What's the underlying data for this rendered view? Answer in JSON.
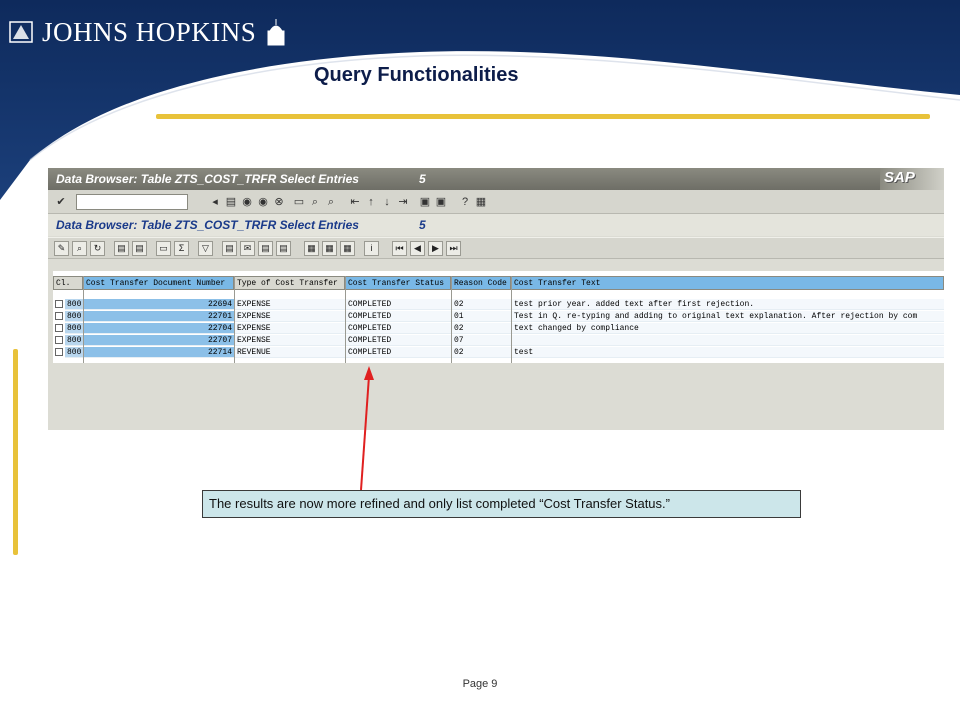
{
  "slide": {
    "brand": "JOHNS HOPKINS",
    "title": "Query Functionalities",
    "footer": "Page 9"
  },
  "sap": {
    "window_title": "Data Browser: Table ZTS_COST_TRFR Select Entries",
    "window_count": "5",
    "screen_title": "Data Browser: Table ZTS_COST_TRFR Select Entries",
    "screen_count": "5",
    "logo": "SAP"
  },
  "grid": {
    "columns": [
      "Cl.",
      "Cost Transfer Document Number",
      "Type of Cost Transfer",
      "Cost Transfer Status",
      "Reason Code",
      "Cost Transfer Text"
    ],
    "rows": [
      [
        "800",
        "22694",
        "EXPENSE",
        "COMPLETED",
        "02",
        "test prior year.  added text after first rejection."
      ],
      [
        "800",
        "22701",
        "EXPENSE",
        "COMPLETED",
        "01",
        "Test in Q. re-typing and adding to original text explanation.  After rejection by com"
      ],
      [
        "800",
        "22704",
        "EXPENSE",
        "COMPLETED",
        "02",
        "text changed by compliance"
      ],
      [
        "800",
        "22707",
        "EXPENSE",
        "COMPLETED",
        "07",
        ""
      ],
      [
        "800",
        "22714",
        "REVENUE",
        "COMPLETED",
        "02",
        "test"
      ]
    ]
  },
  "callout": {
    "text": "The results are now more refined and only list completed “Cost Transfer Status.”"
  },
  "colors": {
    "navy": "#0e2a5c",
    "gold": "#e8c23a",
    "arrow": "#e02020",
    "callout_bg": "#cce6ea"
  }
}
